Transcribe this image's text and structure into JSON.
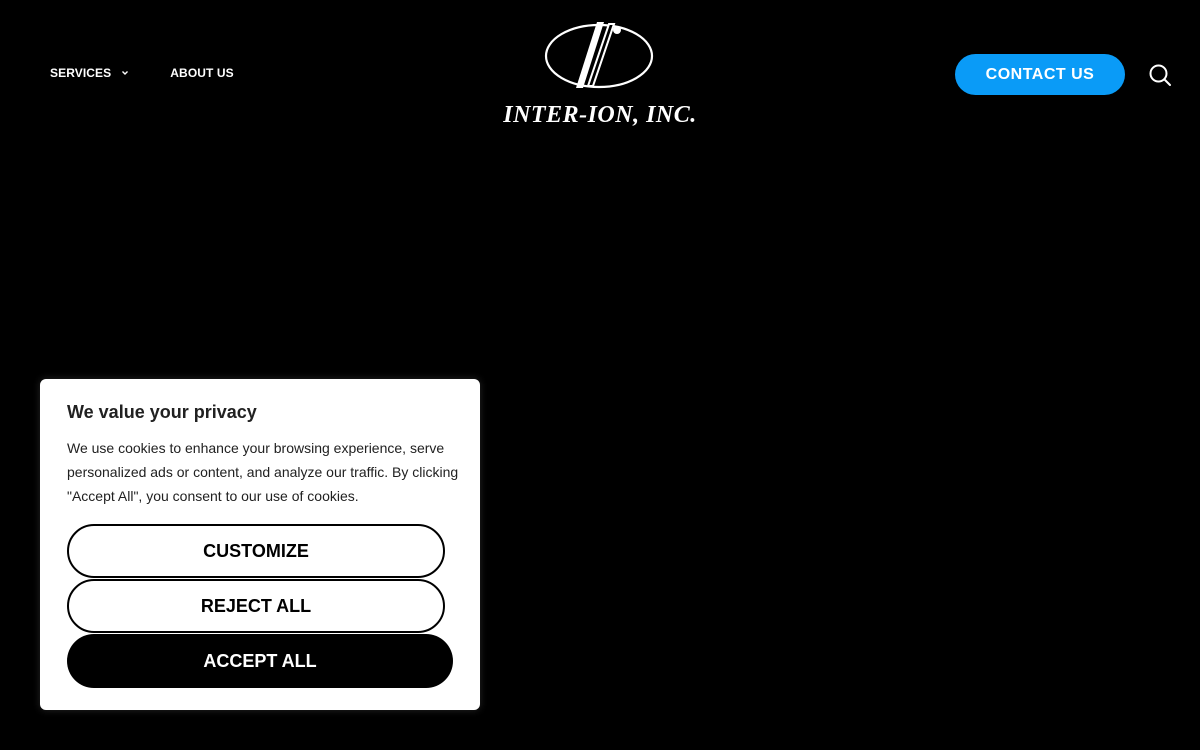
{
  "header": {
    "nav": [
      {
        "label": "SERVICES",
        "has_dropdown": true,
        "icon": "chevron-down-icon"
      },
      {
        "label": "ABOUT US",
        "has_dropdown": false
      }
    ],
    "logo": {
      "text": "INTER-ION, INC.",
      "icon": "inter-ion-logo-mark"
    },
    "contact_label": "CONTACT US",
    "search_icon": "search-icon",
    "accent_color": "#0a9bf7"
  },
  "cookie_banner": {
    "title": "We value your privacy",
    "text": "We use cookies to enhance your browsing experience, serve personalized ads or content, and analyze our traffic. By clicking \"Accept All\", you consent to our use of cookies.",
    "customize_label": "CUSTOMIZE",
    "reject_label": "REJECT ALL",
    "accept_label": "ACCEPT ALL"
  }
}
